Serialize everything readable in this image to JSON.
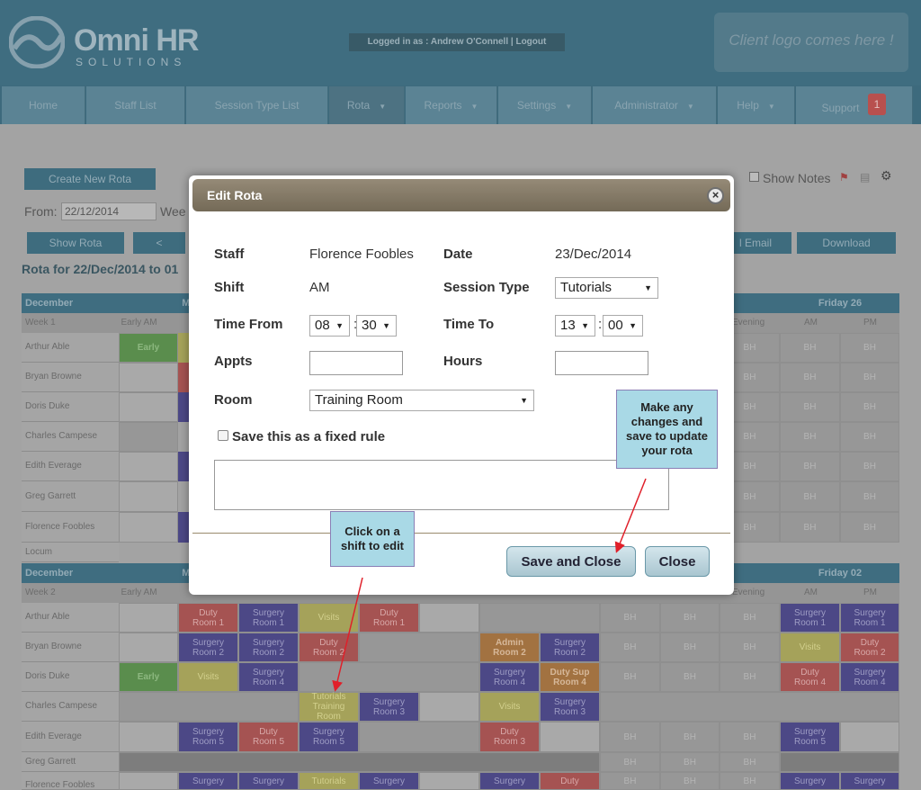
{
  "brand": {
    "name": "Omni HR",
    "sub": "SOLUTIONS"
  },
  "login": {
    "text": "Logged in as : Andrew O'Connell | Logout"
  },
  "client_logo": "Client logo comes here !",
  "nav": [
    {
      "label": "Home"
    },
    {
      "label": "Staff List"
    },
    {
      "label": "Session Type List"
    },
    {
      "label": "Rota"
    },
    {
      "label": "Reports"
    },
    {
      "label": "Settings"
    },
    {
      "label": "Administrator"
    },
    {
      "label": "Help"
    },
    {
      "label": "Support",
      "badge": "1"
    }
  ],
  "toolbar": {
    "create_label": "Create New Rota",
    "from_label": "From:",
    "from_value": "22/12/2014",
    "week_label": "Wee",
    "show_rota": "Show Rota",
    "prev": "<",
    "email": "l Email",
    "download": "Download",
    "show_notes": "Show Notes",
    "rota_for": "Rota for 22/Dec/2014 to 01"
  },
  "grid": {
    "week1": {
      "month": "December",
      "day_initial": "M",
      "friday": "Friday 26",
      "week": "Week 1",
      "early_am": "Early AM",
      "evening": "Evening",
      "am": "AM",
      "pm": "PM",
      "names": [
        "Arthur Able",
        "Bryan Browne",
        "Doris Duke",
        "Charles Campese",
        "Edith Everage",
        "Greg Garrett",
        "Florence Foobles",
        "Locum"
      ],
      "early": "Early",
      "bh": "BH"
    },
    "week2": {
      "month": "December",
      "day_initial": "M",
      "friday": "Friday 02",
      "week": "Week 2",
      "early_am": "Early AM",
      "evening": "Evening",
      "am": "AM",
      "pm": "PM",
      "names": [
        "Arthur Able",
        "Bryan Browne",
        "Doris Duke",
        "Charles Campese",
        "Edith Everage",
        "Greg Garrett",
        "Florence Foobles"
      ]
    }
  },
  "modal": {
    "title": "Edit Rota",
    "close_icon": "×",
    "staff_label": "Staff",
    "staff_value": "Florence Foobles",
    "date_label": "Date",
    "date_value": "23/Dec/2014",
    "shift_label": "Shift",
    "shift_value": "AM",
    "session_label": "Session Type",
    "session_value": "Tutorials",
    "time_from_label": "Time From",
    "from_hour": "08",
    "from_min": "30",
    "time_to_label": "Time To",
    "to_hour": "13",
    "to_min": "00",
    "colon": ":",
    "appts_label": "Appts",
    "hours_label": "Hours",
    "room_label": "Room",
    "room_value": "Training Room",
    "fixed_rule_label": "Save this as a fixed rule",
    "save_close": "Save and Close",
    "close": "Close"
  },
  "callouts": {
    "edit_shift": "Click on a shift to edit",
    "make_changes": "Make any changes and save to update your rota"
  },
  "cells": {
    "duty_room1": [
      "Duty",
      "Room 1"
    ],
    "surgery_room1": [
      "Surgery",
      "Room 1"
    ],
    "visits": "Visits",
    "surgery_room2": [
      "Surgery",
      "Room 2"
    ],
    "duty_room2": [
      "Duty",
      "Room 2"
    ],
    "admin_room2": [
      "Admin",
      "Room 2"
    ],
    "surgery_room4": [
      "Surgery",
      "Room 4"
    ],
    "duty_sup_room4": [
      "Duty Sup",
      "Room 4"
    ],
    "duty_room4": [
      "Duty",
      "Room 4"
    ],
    "tutorials_training": [
      "Tutorials",
      "Training Room"
    ],
    "surgery_room3": [
      "Surgery",
      "Room 3"
    ],
    "surgery_room5": [
      "Surgery",
      "Room 5"
    ],
    "duty_room5": [
      "Duty",
      "Room 5"
    ],
    "duty_room3": [
      "Duty",
      "Room 3"
    ],
    "surgery": "Surgery",
    "duty": "Duty",
    "tutorials": "Tutorials",
    "bh": "BH",
    "early": "Early"
  },
  "colors": {
    "accent": "#3f6d80",
    "modal_bar": "#857a66",
    "button": "#b8d3dc",
    "callout": "#a9d9e6",
    "arrow": "#e0202a"
  }
}
